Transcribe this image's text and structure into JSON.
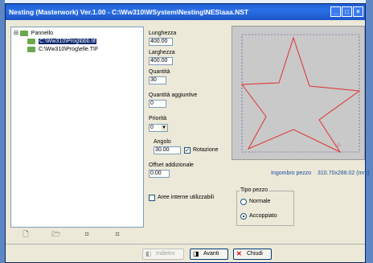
{
  "window": {
    "title": "Nesting (Masterwork) Ver.1.00 - C:\\Ww310\\WSystem\\Nesting\\NES\\aaa.NST",
    "controls": [
      "_",
      "□",
      "×"
    ]
  },
  "tree": {
    "root_label": "Pannello",
    "items": [
      {
        "label": "C:\\Ww310\\Prog\\bbb.tif",
        "selected": true
      },
      {
        "label": "C:\\Ww310\\Prog\\elle.TIF",
        "selected": false
      }
    ],
    "toolbar_icons": [
      "new-icon",
      "open-icon",
      "tool-icon-1",
      "tool-icon-2"
    ],
    "toolbar_glyphs": [
      "🗋",
      "🗁",
      "⌗",
      "⌗"
    ]
  },
  "form": {
    "lunghezza_label": "Lunghezza",
    "lunghezza_value": "400.00",
    "larghezza_label": "Larghezza",
    "larghezza_value": "400.00",
    "quantita_label": "Quantità",
    "quantita_value": "30",
    "quantita_agg_label": "Quantità aggiuntive",
    "quantita_agg_value": "0",
    "priorita_label": "Priorità",
    "priorita_value": "0",
    "angolo_label": "Angolo",
    "angolo_value": "30.00",
    "rotazione_label": "Rotazione",
    "rotazione_checked": true,
    "offset_label": "Offset addizionale",
    "offset_value": "0.00",
    "aree_label": "Aree interne utilizzabili",
    "aree_checked": false
  },
  "preview": {
    "ingombro_label": "Ingombro pezzo",
    "ingombro_value": "310.70x288.02 (mm)",
    "shape_color": "#e03030"
  },
  "tipo_pezzo": {
    "title": "Tipo pezzo",
    "options": [
      {
        "label": "Normale",
        "selected": false
      },
      {
        "label": "Accoppiato",
        "selected": true
      }
    ]
  },
  "buttons": {
    "indietro": "Indietro",
    "avanti": "Avanti",
    "chiudi": "Chiudi"
  }
}
